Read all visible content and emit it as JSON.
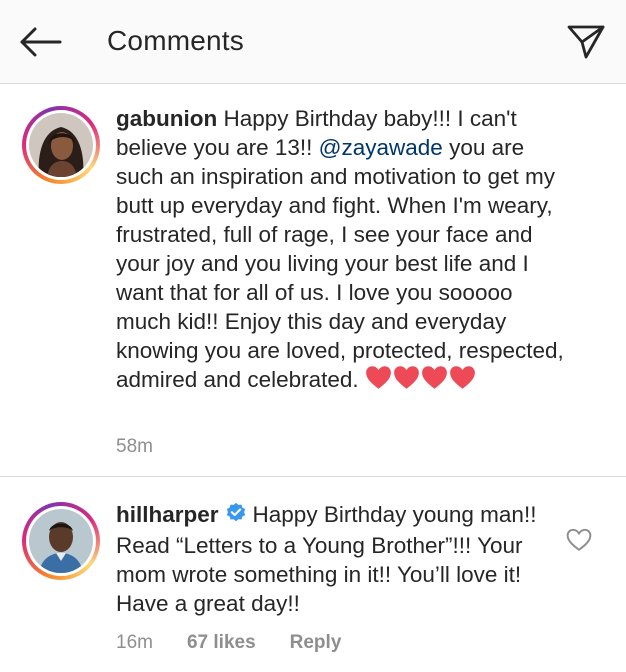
{
  "header": {
    "title": "Comments",
    "back_icon": "arrow-left-icon",
    "share_icon": "paper-plane-icon"
  },
  "comments": [
    {
      "username": "gabunion",
      "text_before_mention": "Happy Birthday baby!!! I can't believe you are 13!!",
      "mention": "@zayawade",
      "text_after_mention": "you are such an inspiration and motivation to get my butt up everyday and fight. When I'm weary, frustrated, full of rage, I see your face and your joy and you living your best life and I want that for all of us. I love you sooooo much kid!! Enjoy this day and everyday knowing you are loved, protected, respected, admired and celebrated.",
      "hearts": [
        "❤",
        "❤",
        "❤",
        "❤"
      ],
      "timestamp": "58m"
    },
    {
      "username": "hillharper",
      "verified": true,
      "text": "Happy Birthday young man!! Read “Letters to a Young Brother”!!! Your mom wrote something in it!! You’ll love it! Have a great day!!",
      "timestamp": "16m",
      "likes": "67 likes",
      "reply": "Reply"
    }
  ],
  "colors": {
    "text": "#262626",
    "meta": "#8e8e8e",
    "mention": "#003569",
    "verified": "#3897f0",
    "heart": "#ed4956",
    "divider": "#dbdbdb"
  }
}
